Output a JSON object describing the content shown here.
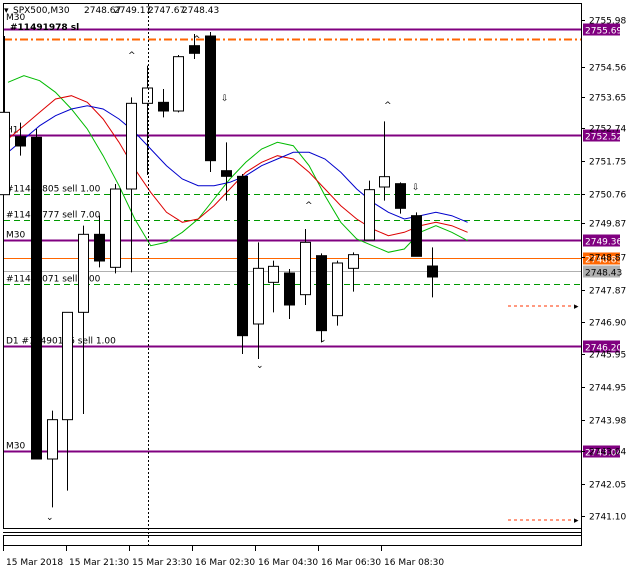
{
  "header": {
    "symbol": "SPX500,M30",
    "ohlc": [
      "2748.67",
      "2749.17",
      "2747.67",
      "2748.43"
    ]
  },
  "overlay": {
    "ticket_label": "#11491978 sl"
  },
  "chart_data": {
    "type": "candlestick",
    "symbol": "SPX500",
    "timeframe": "M30",
    "ylim": [
      2740.73,
      2756.45
    ],
    "y_ticks": [
      2755.98,
      2754.56,
      2753.65,
      2752.74,
      2751.75,
      2750.76,
      2749.87,
      2748.87,
      2747.87,
      2746.9,
      2745.95,
      2744.95,
      2743.98,
      2743.04,
      2742.05,
      2741.1
    ],
    "y_tick_labels": [
      "2755.98",
      "2754.56",
      "2753.65",
      "2752.74",
      "2751.75",
      "2750.76",
      "2749.87",
      "2748.87",
      "2747.87",
      "2746.90",
      "2745.95",
      "2744.95",
      "2743.98",
      "2743.04",
      "2742.05",
      "2741.10"
    ],
    "x_labels": [
      "15 Mar 2018",
      "15 Mar 21:30",
      "15 Mar 23:30",
      "16 Mar 02:30",
      "16 Mar 04:30",
      "16 Mar 06:30",
      "16 Mar 08:30"
    ],
    "candles": [
      {
        "open": 2750.73,
        "high": 2755.49,
        "low": 2750.73,
        "close": 2753.2,
        "bull": true
      },
      {
        "open": 2752.47,
        "high": 2752.89,
        "low": 2751.9,
        "close": 2752.19,
        "bull": false
      },
      {
        "open": 2752.45,
        "high": 2752.7,
        "low": 2742.8,
        "close": 2742.8,
        "bull": false
      },
      {
        "open": 2742.8,
        "high": 2744.25,
        "low": 2741.35,
        "close": 2743.98,
        "bull": true
      },
      {
        "open": 2743.98,
        "high": 2747.2,
        "low": 2741.85,
        "close": 2747.2,
        "bull": true
      },
      {
        "open": 2747.2,
        "high": 2749.8,
        "low": 2744.15,
        "close": 2749.54,
        "bull": true
      },
      {
        "open": 2749.54,
        "high": 2750.1,
        "low": 2748.55,
        "close": 2748.74,
        "bull": false
      },
      {
        "open": 2748.55,
        "high": 2751.05,
        "low": 2748.37,
        "close": 2750.9,
        "bull": true
      },
      {
        "open": 2750.9,
        "high": 2753.65,
        "low": 2748.4,
        "close": 2753.47,
        "bull": true
      },
      {
        "open": 2753.47,
        "high": 2754.6,
        "low": 2751.32,
        "close": 2753.93,
        "bull": true
      },
      {
        "open": 2753.5,
        "high": 2753.9,
        "low": 2753.05,
        "close": 2753.24,
        "bull": false
      },
      {
        "open": 2753.24,
        "high": 2754.92,
        "low": 2753.2,
        "close": 2754.87,
        "bull": true
      },
      {
        "open": 2755.2,
        "high": 2755.55,
        "low": 2754.8,
        "close": 2754.97,
        "bull": false
      },
      {
        "open": 2755.49,
        "high": 2755.61,
        "low": 2751.41,
        "close": 2751.75,
        "bull": false
      },
      {
        "open": 2751.45,
        "high": 2752.3,
        "low": 2750.55,
        "close": 2751.28,
        "bull": false
      },
      {
        "open": 2751.28,
        "high": 2751.35,
        "low": 2745.95,
        "close": 2746.5,
        "bull": false
      },
      {
        "open": 2746.85,
        "high": 2749.3,
        "low": 2745.8,
        "close": 2748.52,
        "bull": true
      },
      {
        "open": 2748.1,
        "high": 2748.75,
        "low": 2747.2,
        "close": 2748.58,
        "bull": true
      },
      {
        "open": 2748.38,
        "high": 2748.5,
        "low": 2747.0,
        "close": 2747.42,
        "bull": false
      },
      {
        "open": 2747.73,
        "high": 2749.7,
        "low": 2747.42,
        "close": 2749.3,
        "bull": true
      },
      {
        "open": 2748.9,
        "high": 2748.97,
        "low": 2746.3,
        "close": 2746.65,
        "bull": false
      },
      {
        "open": 2747.1,
        "high": 2748.75,
        "low": 2746.8,
        "close": 2748.68,
        "bull": true
      },
      {
        "open": 2748.52,
        "high": 2749.0,
        "low": 2747.82,
        "close": 2748.93,
        "bull": true
      },
      {
        "open": 2749.37,
        "high": 2751.15,
        "low": 2749.37,
        "close": 2750.88,
        "bull": true
      },
      {
        "open": 2750.96,
        "high": 2752.93,
        "low": 2750.55,
        "close": 2751.27,
        "bull": true
      },
      {
        "open": 2751.06,
        "high": 2751.1,
        "low": 2750.16,
        "close": 2750.32,
        "bull": false
      },
      {
        "open": 2750.1,
        "high": 2750.2,
        "low": 2748.88,
        "close": 2748.88,
        "bull": false
      },
      {
        "open": 2748.59,
        "high": 2749.15,
        "low": 2747.65,
        "close": 2748.26,
        "bull": false
      }
    ],
    "moving_averages": [
      {
        "color": "#00bb00",
        "values": [
          2754.1,
          2754.3,
          2754.15,
          2753.8,
          2753.3,
          2752.7,
          2751.9,
          2751.0,
          2750.0,
          2749.2,
          2749.3,
          2749.6,
          2750.0,
          2750.6,
          2751.2,
          2751.7,
          2752.1,
          2752.3,
          2752.2,
          2751.6,
          2750.7,
          2749.9,
          2749.4,
          2749.2,
          2749.0,
          2749.1,
          2749.6,
          2749.8,
          2749.6,
          2749.35
        ]
      },
      {
        "color": "#dd0000",
        "values": [
          2752.4,
          2752.8,
          2753.2,
          2753.6,
          2753.7,
          2753.5,
          2753.0,
          2752.3,
          2751.5,
          2750.8,
          2750.2,
          2749.9,
          2750.0,
          2750.4,
          2750.9,
          2751.4,
          2751.7,
          2751.9,
          2751.8,
          2751.4,
          2750.9,
          2750.4,
          2750.0,
          2749.7,
          2749.5,
          2749.6,
          2749.8,
          2749.9,
          2749.8,
          2749.6
        ]
      },
      {
        "color": "#0000cc",
        "values": [
          2752.0,
          2752.4,
          2752.8,
          2753.1,
          2753.3,
          2753.4,
          2753.3,
          2753.0,
          2752.6,
          2752.1,
          2751.6,
          2751.2,
          2751.0,
          2751.0,
          2751.1,
          2751.3,
          2751.6,
          2751.8,
          2752.0,
          2752.0,
          2751.8,
          2751.4,
          2750.9,
          2750.5,
          2750.2,
          2750.0,
          2750.1,
          2750.2,
          2750.1,
          2749.9
        ]
      }
    ],
    "horizontal_lines": [
      {
        "price": 2755.69,
        "label": "2755.69",
        "color": "#800080",
        "style": "solid",
        "tag": ""
      },
      {
        "price": 2755.4,
        "label": "",
        "color": "#ff6600",
        "style": "dashdot",
        "tag": ""
      },
      {
        "price": 2752.52,
        "label": "2752.52",
        "color": "#800080",
        "style": "solid",
        "tag": "H1"
      },
      {
        "price": 2750.76,
        "label": "",
        "color": "#009900",
        "style": "dashed",
        "tag": "#11491805 sell 1.00"
      },
      {
        "price": 2749.97,
        "label": "",
        "color": "#009900",
        "style": "dashed",
        "tag": "#11491777 sell 7.00"
      },
      {
        "price": 2749.36,
        "label": "2749.36",
        "color": "#800080",
        "style": "solid",
        "tag": "M30"
      },
      {
        "price": 2748.83,
        "label": "2748.83",
        "color": "#ff6600",
        "style": "solid",
        "tag": ""
      },
      {
        "price": 2748.43,
        "label": "2748.43",
        "color": "#b0b0b0",
        "style": "solid",
        "tag": ""
      },
      {
        "price": 2748.06,
        "label": "",
        "color": "#009900",
        "style": "dashed",
        "tag": "#11490071 sell 1.00"
      },
      {
        "price": 2746.2,
        "label": "2746.20",
        "color": "#800080",
        "style": "solid",
        "tag": "D1 #11490176 sell 1.00"
      },
      {
        "price": 2743.04,
        "label": "2743.04",
        "color": "#800080",
        "style": "solid",
        "tag": "M30"
      }
    ],
    "vertical_marker_label": "15 Mar 23:30"
  }
}
